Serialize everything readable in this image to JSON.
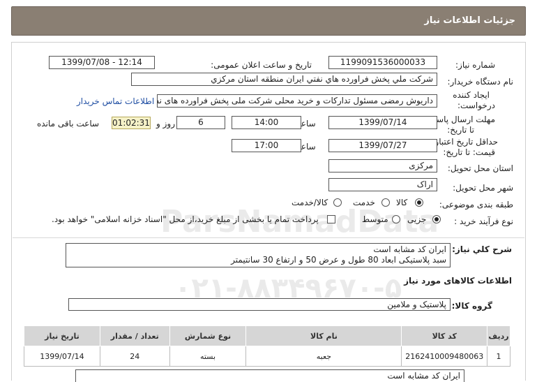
{
  "header": {
    "title": "جزئیات اطلاعات نیاز"
  },
  "form": {
    "need_number_label": "شماره نیاز:",
    "need_number": "1199091536000033",
    "announce_label": "تاریخ و ساعت اعلان عمومی:",
    "announce_value": "1399/07/08 - 12:14",
    "buyer_label": "نام دستگاه خریدار:",
    "buyer_value": "شرکت ملي پخش فراورده هاي نفتي ايران منطقه استان مرکزي",
    "creator_label": "ایجاد کننده",
    "creator_label2": "درخواست:",
    "creator_value": "داریوش رمضی مسئول تدارکات و خرید محلی شرکت ملی پخش فراورده های نفتی",
    "contact_link": "اطلاعات تماس خریدار",
    "deadline_label": "مهلت ارسال پاسخ:",
    "deadline_label2": "تا تاریخ:",
    "deadline_date": "1399/07/14",
    "time_label": "ساعت",
    "deadline_time": "14:00",
    "days_value": "6",
    "days_label": "روز و",
    "remaining_time": "01:02:31",
    "remaining_label": "ساعت باقی مانده",
    "validity_label": "حداقل تاریخ اعتبار",
    "validity_label2": "قیمت: تا تاریخ:",
    "validity_date": "1399/07/27",
    "validity_time": "17:00",
    "province_label": "استان محل تحویل:",
    "province_value": "مرکزی",
    "city_label": "شهر محل تحویل:",
    "city_value": "اراک",
    "category_label": "طبقه بندی موضوعی:",
    "category_options": [
      "کالا",
      "خدمت",
      "کالا/خدمت"
    ],
    "category_selected": "کالا",
    "purchase_label": "نوع فرآیند خرید :",
    "purchase_options": [
      "جزیی",
      "متوسط"
    ],
    "purchase_selected": "جزیی",
    "purchase_note": "پرداخت تمام یا بخشی از مبلغ خرید،از محل \"اسناد خزانه اسلامی\" خواهد بود."
  },
  "summary": {
    "label": "شرح کلي نياز:",
    "line1": "ايران کد مشابه است",
    "line2": "سبد پلاستیکی  ابعاد  80 طول و عرض 50 و ارتفاع 30   سانتیمتر"
  },
  "goods": {
    "section_title": "اطلاعات کالاهای مورد نیاز",
    "group_label": "گروه کالا:",
    "group_value": "پلاستیک و ملامین",
    "columns": [
      "ردیف",
      "کد کالا",
      "نام کالا",
      "نوع شمارش",
      "تعداد / مقدار",
      "تاریخ نیاز"
    ],
    "rows": [
      {
        "row": "1",
        "code": "2162410009480063",
        "name": "جعبه",
        "unit": "بسته",
        "qty": "24",
        "date": "1399/07/14"
      }
    ],
    "note": "ایران کد مشابه است"
  },
  "watermark": {
    "brand": "ParsNamadData",
    "phone": "۰۲۱-۸۸۳۴۹۶۷۰-۵"
  }
}
